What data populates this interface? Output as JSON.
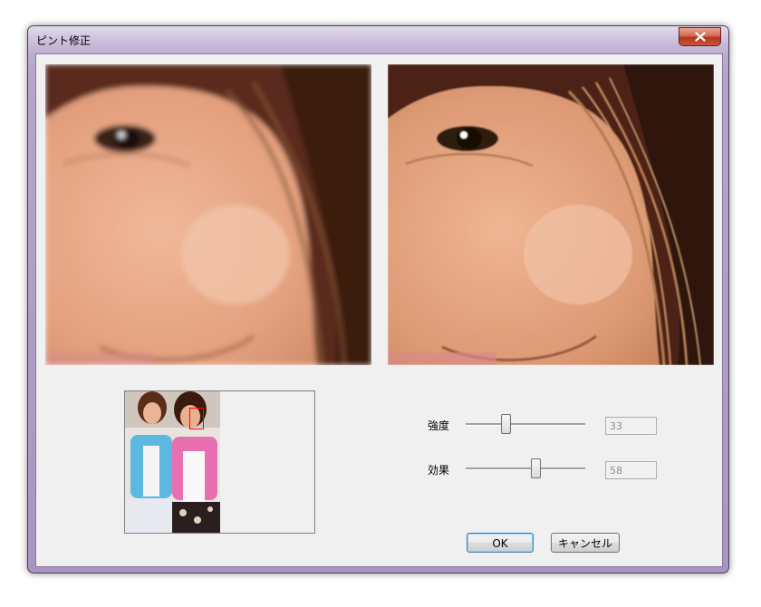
{
  "window": {
    "title": "ピント修正"
  },
  "controls": {
    "strength": {
      "label": "強度",
      "value": "33",
      "percent": 33
    },
    "effect": {
      "label": "効果",
      "value": "58",
      "percent": 58
    }
  },
  "buttons": {
    "ok": "OK",
    "cancel": "キャンセル"
  },
  "icons": {
    "close": "close-icon"
  }
}
